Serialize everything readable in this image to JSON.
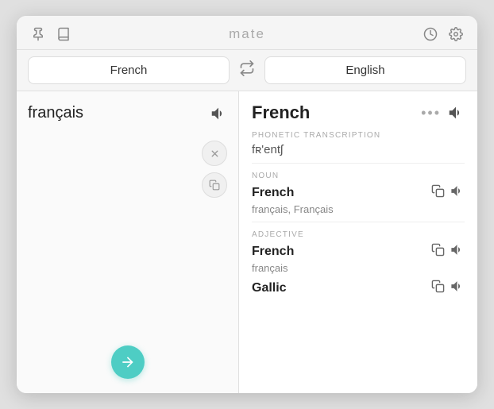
{
  "app": {
    "title": "mate"
  },
  "titlebar": {
    "pin_label": "📌",
    "history_label": "🕐",
    "settings_label": "⚙️",
    "book_label": "📕"
  },
  "langbar": {
    "source_lang": "French",
    "target_lang": "English",
    "swap_icon": "⇄"
  },
  "left": {
    "source_word": "français",
    "close_icon": "✕",
    "copy_icon": "⧉",
    "go_icon": "→"
  },
  "right": {
    "translation_word": "French",
    "more_label": "•••",
    "phonetic_label": "PHONETIC TRANSCRIPTION",
    "phonetic": "fʀ'entʃ",
    "noun_label": "NOUN",
    "noun_entries": [
      {
        "word": "French",
        "sub": "français, Français"
      }
    ],
    "adjective_label": "ADJECTIVE",
    "adjective_entries": [
      {
        "word": "French",
        "sub": "français"
      },
      {
        "word": "Gallic",
        "sub": ""
      }
    ]
  }
}
